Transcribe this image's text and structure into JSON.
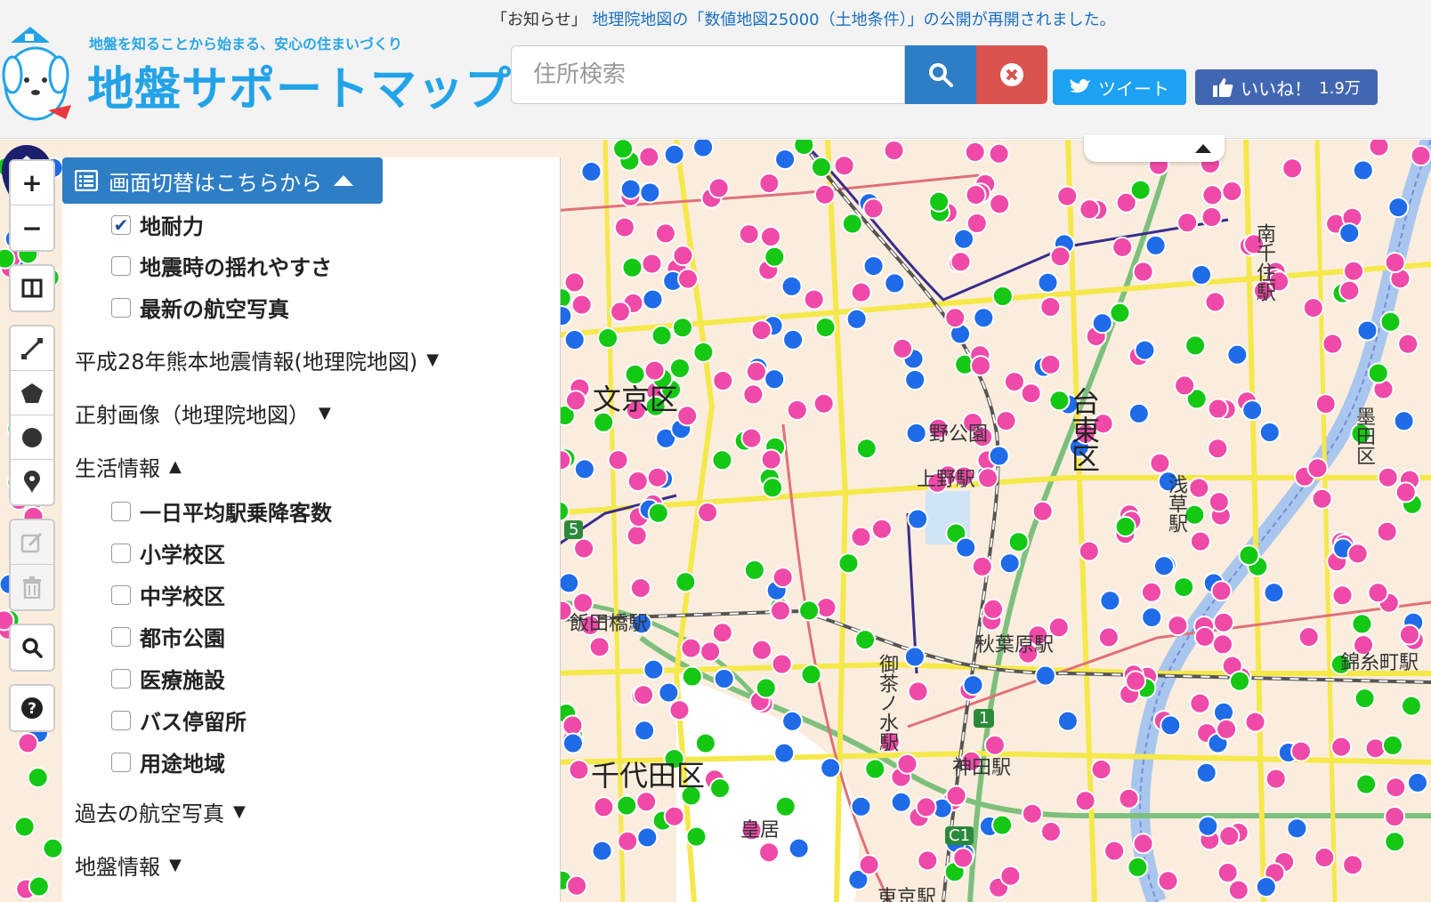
{
  "header": {
    "tagline": "地盤を知ることから始まる、安心の住まいづくり",
    "title": "地盤サポートマップ",
    "notice_prefix": "「お知らせ」",
    "notice_text": "地理院地図の「数値地図25000（土地条件）」の公開が再開されました。",
    "search_placeholder": "住所検索",
    "tweet_label": "ツイート",
    "like_label": "いいね！",
    "like_count": "1.9万"
  },
  "colors": {
    "brand": "#22a3e8",
    "search_button": "#2d7ec5",
    "clear_button": "#d9534f",
    "tweet": "#1da1f2",
    "like": "#4267b2",
    "marker_pink": "#f04aa8",
    "marker_blue": "#1f6be8",
    "marker_green": "#14c814",
    "pin": "#1a1f6e"
  },
  "panel": {
    "header_label": "画面切替はこちらから",
    "switch_items": [
      {
        "label": "地耐力",
        "checked": true
      },
      {
        "label": "地震時の揺れやすさ",
        "checked": false
      },
      {
        "label": "最新の航空写真",
        "checked": false
      }
    ],
    "sections": {
      "kumamoto": "平成28年熊本地震情報(地理院地図)",
      "ortho": "正射画像（地理院地図）",
      "life": "生活情報",
      "past_photos": "過去の航空写真",
      "ground": "地盤情報"
    },
    "life_items": [
      {
        "label": "一日平均駅乗降客数",
        "checked": false
      },
      {
        "label": "小学校区",
        "checked": false
      },
      {
        "label": "中学校区",
        "checked": false
      },
      {
        "label": "都市公園",
        "checked": false
      },
      {
        "label": "医療施設",
        "checked": false
      },
      {
        "label": "バス停留所",
        "checked": false
      },
      {
        "label": "用途地域",
        "checked": false
      }
    ]
  },
  "toolbar": {
    "zoom_in": "+",
    "zoom_out": "−"
  },
  "map": {
    "labels": {
      "bunkyo": "文京区",
      "taito": "台東区",
      "chiyoda": "千代田区",
      "kokyo": "皇居",
      "ueno_park": "野公園",
      "ueno_station": "上野駅",
      "akihabara": "秋葉原駅",
      "iidabashi": "飯田橋駅",
      "kinshicho": "錦糸町駅",
      "ochanomizu": "御茶ノ水駅",
      "kanda": "神田駅",
      "asakusa": "浅草駅",
      "minami": "南千住駅",
      "tokyo_station": "東京駅",
      "sumida": "墨田区",
      "route5": "5",
      "route1": "1",
      "routec1": "C1"
    }
  }
}
